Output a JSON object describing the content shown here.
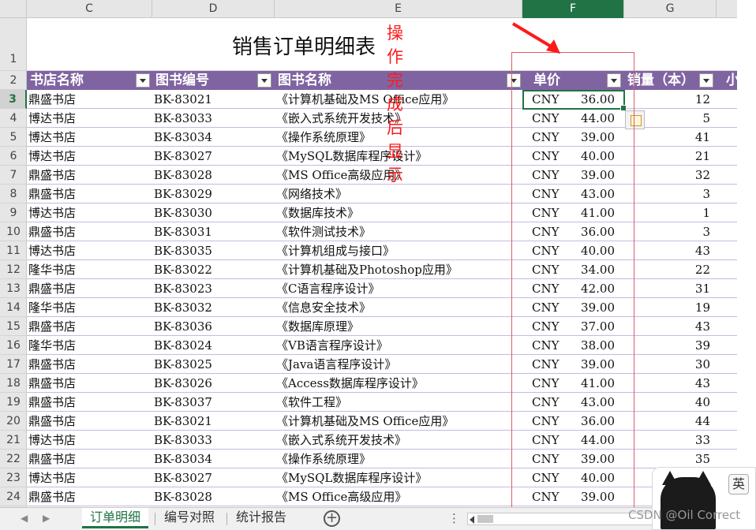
{
  "sheet": {
    "columns": [
      {
        "key": "C",
        "label": "C"
      },
      {
        "key": "D",
        "label": "D"
      },
      {
        "key": "E",
        "label": "E"
      },
      {
        "key": "F",
        "label": "F"
      },
      {
        "key": "G",
        "label": "G"
      }
    ],
    "row_numbers": [
      "1",
      "2",
      "3",
      "4",
      "5",
      "6",
      "7",
      "8",
      "9",
      "10",
      "11",
      "12",
      "13",
      "14",
      "15",
      "16",
      "17",
      "18",
      "19",
      "20",
      "21",
      "22",
      "23",
      "24"
    ],
    "title": "销售订单明细表",
    "headers": {
      "store": "书店名称",
      "book_id": "图书编号",
      "book_name": "图书名称",
      "price": "单价",
      "qty": "销量（本）",
      "next": "小"
    },
    "rows": [
      {
        "store": "鼎盛书店",
        "book_id": "BK-83021",
        "book_name": "《计算机基础及MS Office应用》",
        "currency": "CNY",
        "price": "36.00",
        "qty": "12"
      },
      {
        "store": "博达书店",
        "book_id": "BK-83033",
        "book_name": "《嵌入式系统开发技术》",
        "currency": "CNY",
        "price": "44.00",
        "qty": "5"
      },
      {
        "store": "博达书店",
        "book_id": "BK-83034",
        "book_name": "《操作系统原理》",
        "currency": "CNY",
        "price": "39.00",
        "qty": "41"
      },
      {
        "store": "博达书店",
        "book_id": "BK-83027",
        "book_name": "《MySQL数据库程序设计》",
        "currency": "CNY",
        "price": "40.00",
        "qty": "21"
      },
      {
        "store": "鼎盛书店",
        "book_id": "BK-83028",
        "book_name": "《MS Office高级应用》",
        "currency": "CNY",
        "price": "39.00",
        "qty": "32"
      },
      {
        "store": "鼎盛书店",
        "book_id": "BK-83029",
        "book_name": "《网络技术》",
        "currency": "CNY",
        "price": "43.00",
        "qty": "3"
      },
      {
        "store": "博达书店",
        "book_id": "BK-83030",
        "book_name": "《数据库技术》",
        "currency": "CNY",
        "price": "41.00",
        "qty": "1"
      },
      {
        "store": "鼎盛书店",
        "book_id": "BK-83031",
        "book_name": "《软件测试技术》",
        "currency": "CNY",
        "price": "36.00",
        "qty": "3"
      },
      {
        "store": "博达书店",
        "book_id": "BK-83035",
        "book_name": "《计算机组成与接口》",
        "currency": "CNY",
        "price": "40.00",
        "qty": "43"
      },
      {
        "store": "隆华书店",
        "book_id": "BK-83022",
        "book_name": "《计算机基础及Photoshop应用》",
        "currency": "CNY",
        "price": "34.00",
        "qty": "22"
      },
      {
        "store": "鼎盛书店",
        "book_id": "BK-83023",
        "book_name": "《C语言程序设计》",
        "currency": "CNY",
        "price": "42.00",
        "qty": "31"
      },
      {
        "store": "隆华书店",
        "book_id": "BK-83032",
        "book_name": "《信息安全技术》",
        "currency": "CNY",
        "price": "39.00",
        "qty": "19"
      },
      {
        "store": "鼎盛书店",
        "book_id": "BK-83036",
        "book_name": "《数据库原理》",
        "currency": "CNY",
        "price": "37.00",
        "qty": "43"
      },
      {
        "store": "隆华书店",
        "book_id": "BK-83024",
        "book_name": "《VB语言程序设计》",
        "currency": "CNY",
        "price": "38.00",
        "qty": "39"
      },
      {
        "store": "鼎盛书店",
        "book_id": "BK-83025",
        "book_name": "《Java语言程序设计》",
        "currency": "CNY",
        "price": "39.00",
        "qty": "30"
      },
      {
        "store": "鼎盛书店",
        "book_id": "BK-83026",
        "book_name": "《Access数据库程序设计》",
        "currency": "CNY",
        "price": "41.00",
        "qty": "43"
      },
      {
        "store": "鼎盛书店",
        "book_id": "BK-83037",
        "book_name": "《软件工程》",
        "currency": "CNY",
        "price": "43.00",
        "qty": "40"
      },
      {
        "store": "鼎盛书店",
        "book_id": "BK-83021",
        "book_name": "《计算机基础及MS Office应用》",
        "currency": "CNY",
        "price": "36.00",
        "qty": "44"
      },
      {
        "store": "博达书店",
        "book_id": "BK-83033",
        "book_name": "《嵌入式系统开发技术》",
        "currency": "CNY",
        "price": "44.00",
        "qty": "33"
      },
      {
        "store": "鼎盛书店",
        "book_id": "BK-83034",
        "book_name": "《操作系统原理》",
        "currency": "CNY",
        "price": "39.00",
        "qty": "35"
      },
      {
        "store": "博达书店",
        "book_id": "BK-83027",
        "book_name": "《MySQL数据库程序设计》",
        "currency": "CNY",
        "price": "40.00",
        "qty": ""
      },
      {
        "store": "鼎盛书店",
        "book_id": "BK-83028",
        "book_name": "《MS Office高级应用》",
        "currency": "CNY",
        "price": "39.00",
        "qty": ""
      }
    ]
  },
  "annotation": "操作完成后显示",
  "tabs": [
    "订单明细",
    "编号对照",
    "统计报告"
  ],
  "active_tab": 0,
  "ime_label": "英",
  "watermark": "CSDN @Oil Correct",
  "colors": {
    "header_bg": "#8064a2",
    "row_border": "#c9b8df",
    "accent_green": "#217346",
    "annotation_red": "#ff1a1a"
  }
}
